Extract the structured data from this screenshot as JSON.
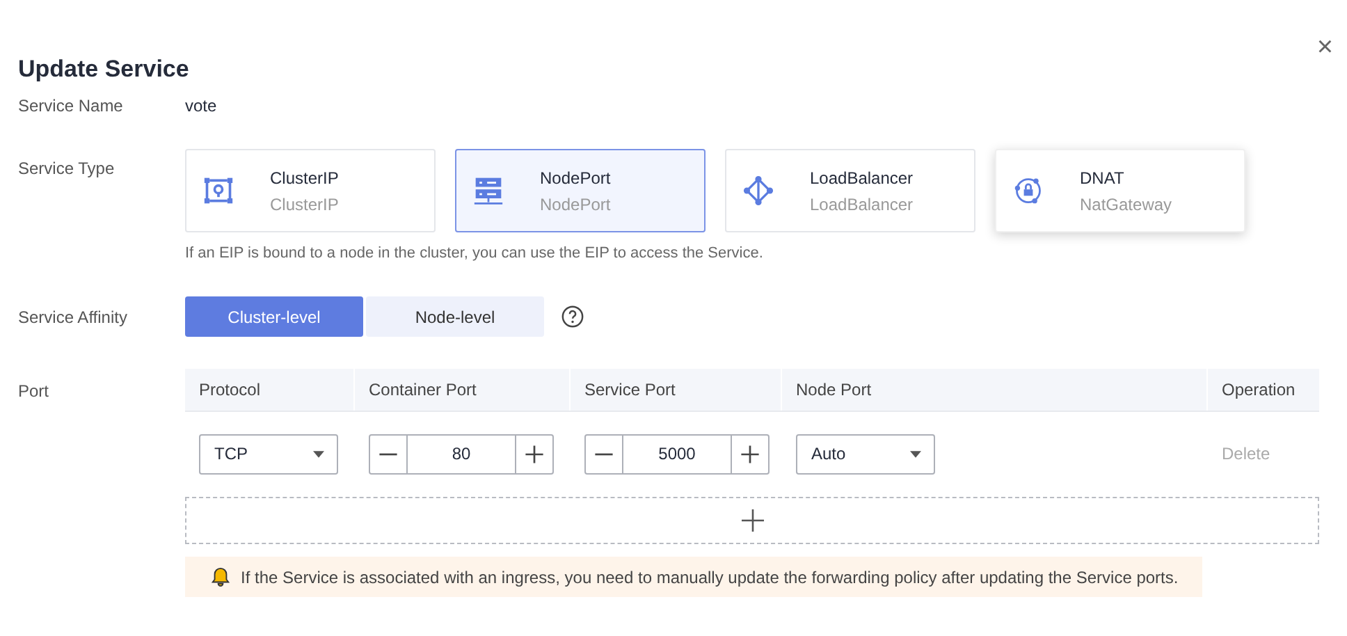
{
  "dialog": {
    "title": "Update Service",
    "close_icon": "×"
  },
  "service_name": {
    "label": "Service Name",
    "value": "vote"
  },
  "service_type": {
    "label": "Service Type",
    "options": [
      {
        "kind": "cluster",
        "title": "ClusterIP",
        "subtitle": "ClusterIP",
        "selected": false,
        "hovered": false
      },
      {
        "kind": "node",
        "title": "NodePort",
        "subtitle": "NodePort",
        "selected": true,
        "hovered": false
      },
      {
        "kind": "balancer",
        "title": "LoadBalancer",
        "subtitle": "LoadBalancer",
        "selected": false,
        "hovered": false
      },
      {
        "kind": "nat",
        "title": "DNAT",
        "subtitle": "NatGateway",
        "selected": false,
        "hovered": true
      }
    ],
    "hint": "If an EIP is bound to a node in the cluster, you can use the EIP to access the Service."
  },
  "affinity": {
    "label": "Service Affinity",
    "options": [
      {
        "label": "Cluster-level",
        "selected": true
      },
      {
        "label": "Node-level",
        "selected": false
      }
    ]
  },
  "port": {
    "label": "Port",
    "columns": [
      "Protocol",
      "Container Port",
      "Service Port",
      "Node Port",
      "Operation"
    ],
    "rows": [
      {
        "protocol": "TCP",
        "container_port": "80",
        "service_port": "5000",
        "node_port": "Auto",
        "operation": "Delete"
      }
    ]
  },
  "notice": "If the Service is associated with an ingress, you need to manually update the forwarding policy after updating the Service ports."
}
